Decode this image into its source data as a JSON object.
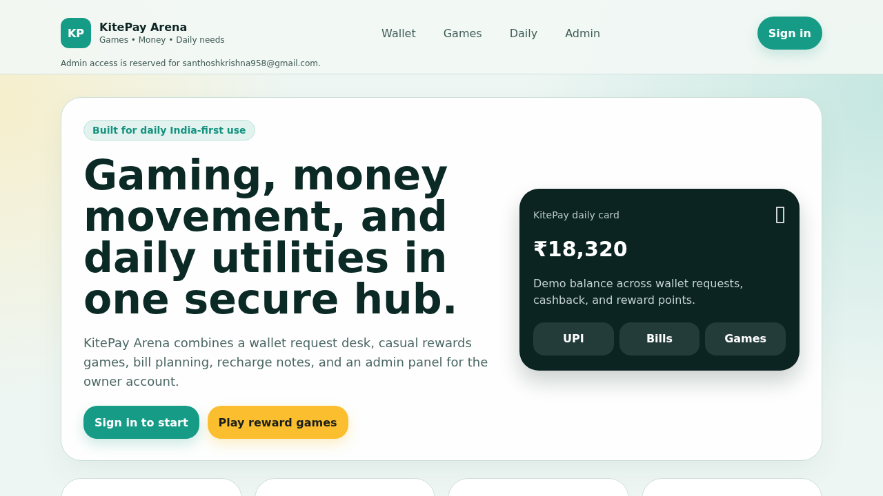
{
  "header": {
    "logo": "KP",
    "brand": "KitePay Arena",
    "tagline": "Games • Money • Daily needs",
    "nav": [
      "Wallet",
      "Games",
      "Daily",
      "Admin"
    ],
    "sign_in": "Sign in",
    "admin_note": "Admin access is reserved for santhoshkrishna958@gmail.com."
  },
  "hero": {
    "badge": "Built for daily India-first use",
    "headline": "Gaming, money movement, and daily utilities in one secure hub.",
    "description": "KitePay Arena combines a wallet request desk, casual rewards games, bill planning, recharge notes, and an admin panel for the owner account.",
    "buttons": [
      {
        "label": "Sign in to start",
        "kind": "primary"
      },
      {
        "label": "Play reward games",
        "kind": "accent"
      }
    ],
    "card": {
      "label": "KitePay daily card",
      "amount": "₹18,320",
      "description": "Demo balance across wallet requests, cashback, and reward points.",
      "actions": [
        "UPI",
        "Bills",
        "Games"
      ]
    }
  }
}
